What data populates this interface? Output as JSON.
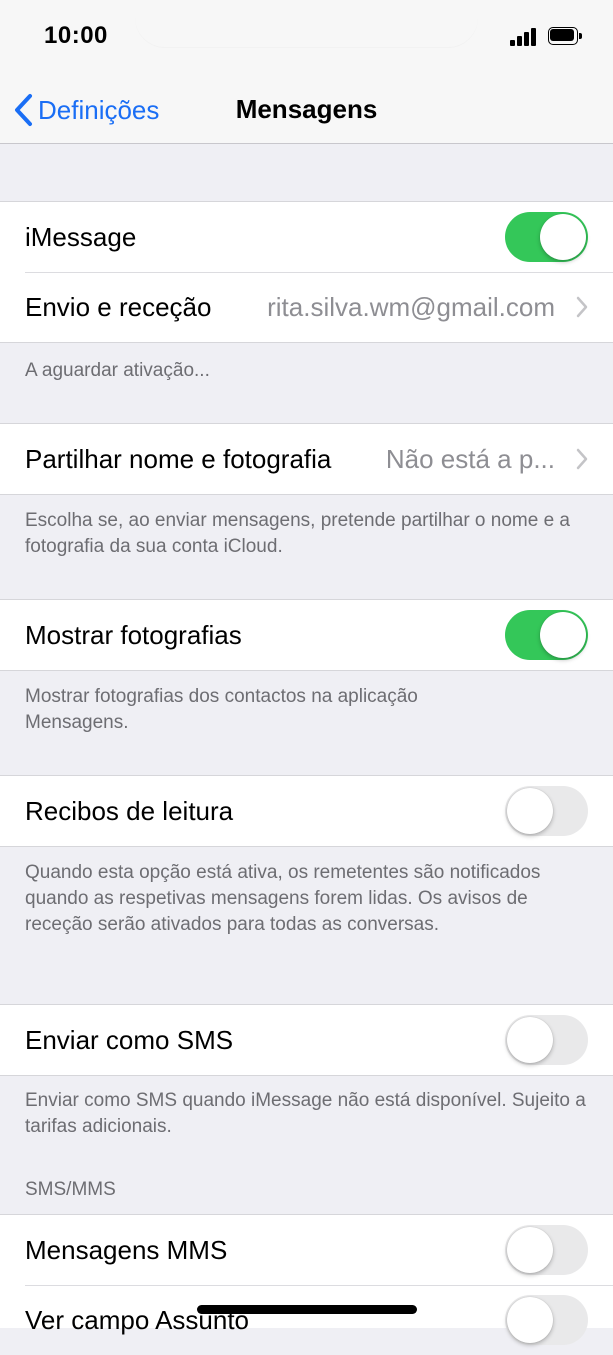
{
  "status_bar": {
    "time": "10:00"
  },
  "nav": {
    "back_label": "Definições",
    "title": "Mensagens"
  },
  "imessage_group": {
    "imessage": {
      "label": "iMessage",
      "enabled": true
    },
    "send_receive": {
      "label": "Envio e receção",
      "value": "rita.silva.wm@gmail.com"
    }
  },
  "imessage_footer": "A aguardar ativação...",
  "share_group": {
    "label": "Partilhar nome e fotografia",
    "value": "Não está a p..."
  },
  "share_footer": "Escolha se, ao enviar mensagens, pretende partilhar o nome e a fotografia da sua conta iCloud.",
  "photos_group": {
    "label": "Mostrar fotografias",
    "enabled": true
  },
  "photos_footer": "Mostrar fotografias dos contactos na aplicação Mensagens.",
  "receipts_group": {
    "label": "Recibos de leitura",
    "enabled": false
  },
  "receipts_footer": "Quando esta opção está ativa, os remetentes são notificados quando as respetivas mensagens forem lidas. Os avisos de receção serão ativados para todas as conversas.",
  "sms_group": {
    "label": "Enviar como SMS",
    "enabled": false
  },
  "sms_footer": "Enviar como SMS quando iMessage não está disponível. Sujeito a tarifas adicionais.",
  "sms_mms_header": "SMS/MMS",
  "mms_group": {
    "mms": {
      "label": "Mensagens MMS",
      "enabled": false
    },
    "subject": {
      "label": "Ver campo Assunto",
      "enabled": false
    }
  },
  "colors": {
    "accent": "#1a6ef5",
    "toggle_on": "#34c759",
    "toggle_off": "#e9e9ea"
  }
}
